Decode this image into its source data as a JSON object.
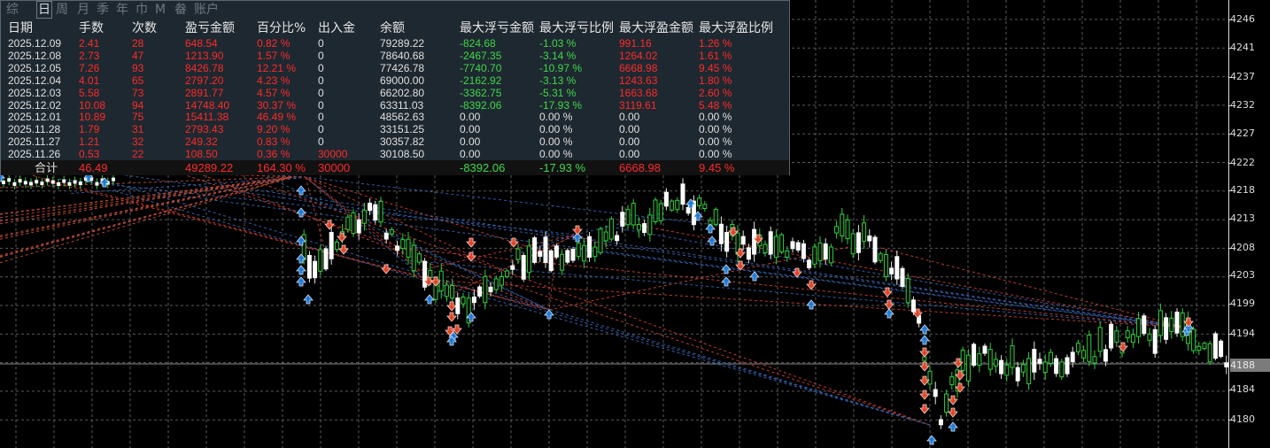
{
  "tabs": [
    "综",
    "日",
    "周",
    "月",
    "季",
    "年",
    "巾",
    "M",
    "畚",
    "账户"
  ],
  "active_tab_index": 1,
  "columns": [
    "日期",
    "手数",
    "次数",
    "盈亏金额",
    "百分比%",
    "出入金",
    "余额",
    "最大浮亏金额",
    "最大浮亏比例",
    "最大浮盈金额",
    "最大浮盈比例"
  ],
  "rows": [
    [
      "2025.12.09",
      "2.41",
      "28",
      "648.54",
      "0.82 %",
      "0",
      "79289.22",
      "-824.68",
      "-1.03 %",
      "991.16",
      "1.26 %"
    ],
    [
      "2025.12.08",
      "2.73",
      "47",
      "1213.90",
      "1.57 %",
      "0",
      "78640.68",
      "-2467.35",
      "-3.14 %",
      "1264.02",
      "1.61 %"
    ],
    [
      "2025.12.05",
      "7.26",
      "93",
      "8426.78",
      "12.21 %",
      "0",
      "77426.78",
      "-7740.70",
      "-10.97 %",
      "6668.98",
      "9.45 %"
    ],
    [
      "2025.12.04",
      "4.01",
      "65",
      "2797.20",
      "4.23 %",
      "0",
      "69000.00",
      "-2162.92",
      "-3.13 %",
      "1243.63",
      "1.80 %"
    ],
    [
      "2025.12.03",
      "5.58",
      "73",
      "2891.77",
      "4.57 %",
      "0",
      "66202.80",
      "-3362.75",
      "-5.31 %",
      "1663.68",
      "2.60 %"
    ],
    [
      "2025.12.02",
      "10.08",
      "94",
      "14748.40",
      "30.37 %",
      "0",
      "63311.03",
      "-8392.06",
      "-17.93 %",
      "3119.61",
      "5.48 %"
    ],
    [
      "2025.12.01",
      "10.89",
      "75",
      "15411.38",
      "46.49 %",
      "0",
      "48562.63",
      "0.00",
      "0.00 %",
      "0.00",
      "0.00 %"
    ],
    [
      "2025.11.28",
      "1.79",
      "31",
      "2793.43",
      "9.20 %",
      "0",
      "33151.25",
      "0.00",
      "0.00 %",
      "0.00",
      "0.00 %"
    ],
    [
      "2025.11.27",
      "1.21",
      "32",
      "249.32",
      "0.83 %",
      "0",
      "30357.82",
      "0.00",
      "0.00 %",
      "0.00",
      "0.00 %"
    ],
    [
      "2025.11.26",
      "0.53",
      "22",
      "108.50",
      "0.36 %",
      "30000",
      "30108.50",
      "0.00",
      "0.00 %",
      "0.00",
      "0.00 %"
    ]
  ],
  "totals": {
    "label": "合计",
    "lots": "46.49",
    "pnl": "49289.22",
    "percent": "164.30 %",
    "deposit": "30000",
    "max_float_loss": "-8392.06",
    "max_float_loss_pct": "-17.93 %",
    "max_float_profit": "6668.98",
    "max_float_profit_pct": "9.45 %"
  },
  "price_axis": [
    "4246",
    "4241",
    "4237",
    "4232",
    "4227",
    "4222",
    "4218",
    "4213",
    "4208",
    "4203",
    "4199",
    "4194",
    "4180",
    "4184",
    "4180"
  ],
  "current_price": "4188",
  "colors": {
    "panel_bg": "#1e2830",
    "loss_red": "#ff2a2a",
    "gain_green": "#3fd84a",
    "candle_up": "#2fd23a",
    "candle_doji": "#ffffff",
    "buy_arrow": "#1f7bd6",
    "sell_arrow": "#e0462a"
  }
}
